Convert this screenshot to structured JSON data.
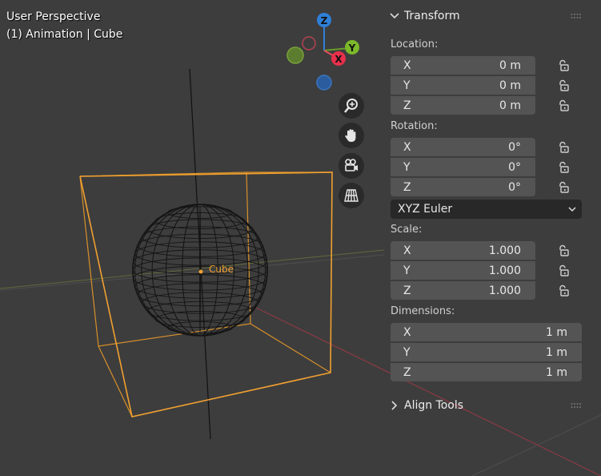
{
  "viewport": {
    "mode": "User Perspective",
    "context": "(1) Animation | Cube",
    "object_label": "Cube",
    "gizmo": {
      "z": "Z",
      "y": "Y",
      "x": "X"
    },
    "colors": {
      "selected_orange": "#f0a030",
      "axis_x": "#e84a5f",
      "axis_y": "#6a9c2a",
      "axis_z": "#2f7fd6"
    },
    "nav_buttons": [
      "zoom-icon",
      "hand-pan-icon",
      "camera-icon",
      "grid-perspective-icon"
    ]
  },
  "transform": {
    "title": "Transform",
    "location": {
      "label": "Location:",
      "rows": [
        {
          "axis": "X",
          "value": "0 m"
        },
        {
          "axis": "Y",
          "value": "0 m"
        },
        {
          "axis": "Z",
          "value": "0 m"
        }
      ]
    },
    "rotation": {
      "label": "Rotation:",
      "rows": [
        {
          "axis": "X",
          "value": "0°"
        },
        {
          "axis": "Y",
          "value": "0°"
        },
        {
          "axis": "Z",
          "value": "0°"
        }
      ],
      "mode": "XYZ Euler"
    },
    "scale": {
      "label": "Scale:",
      "rows": [
        {
          "axis": "X",
          "value": "1.000"
        },
        {
          "axis": "Y",
          "value": "1.000"
        },
        {
          "axis": "Z",
          "value": "1.000"
        }
      ]
    },
    "dimensions": {
      "label": "Dimensions:",
      "rows": [
        {
          "axis": "X",
          "value": "1 m"
        },
        {
          "axis": "Y",
          "value": "1 m"
        },
        {
          "axis": "Z",
          "value": "1 m"
        }
      ]
    }
  },
  "align_tools": {
    "title": "Align Tools"
  }
}
